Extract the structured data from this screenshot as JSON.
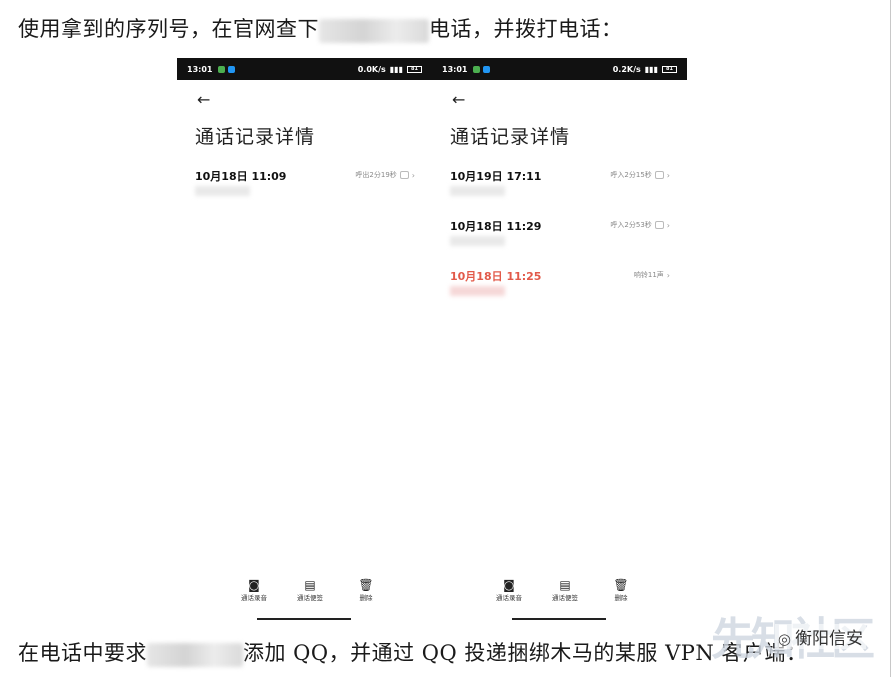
{
  "doc": {
    "line1_before": "使用拿到的序列号，在官网查下",
    "line1_after": "电话，并拨打电话：",
    "line2_before": "在电话中要求",
    "line2_after": "添加 QQ，并通过 QQ 投递捆绑木马的某服 VPN 客户端："
  },
  "phone_a": {
    "status_time": "13:01",
    "status_speed": "0.0K/s",
    "battery": "81",
    "title": "通话记录详情",
    "records": [
      {
        "when": "10月18日 11:09",
        "meta": "呼出2分19秒",
        "missed": false
      }
    ],
    "toolbar": [
      {
        "icon": "recording-icon",
        "glyph": "◙",
        "label": "通话录音"
      },
      {
        "icon": "note-icon",
        "glyph": "▤",
        "label": "通话便签"
      },
      {
        "icon": "trash-icon",
        "glyph": "🗑",
        "label": "删除"
      }
    ]
  },
  "phone_b": {
    "status_time": "13:01",
    "status_speed": "0.2K/s",
    "battery": "81",
    "title": "通话记录详情",
    "records": [
      {
        "when": "10月19日 17:11",
        "meta": "呼入2分15秒",
        "missed": false
      },
      {
        "when": "10月18日 11:29",
        "meta": "呼入2分53秒",
        "missed": false
      },
      {
        "when": "10月18日 11:25",
        "meta": "响铃11声",
        "missed": true
      }
    ],
    "toolbar": [
      {
        "icon": "recording-icon",
        "glyph": "◙",
        "label": "通话录音"
      },
      {
        "icon": "note-icon",
        "glyph": "▤",
        "label": "通话便签"
      },
      {
        "icon": "trash-icon",
        "glyph": "🗑",
        "label": "删除"
      }
    ]
  },
  "watermark": {
    "text": "衡阳信安",
    "logo_text": "先知社区"
  }
}
